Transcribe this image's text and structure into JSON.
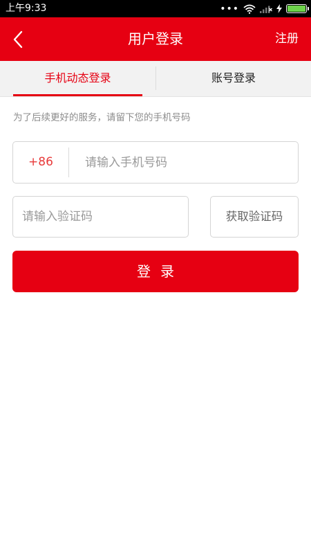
{
  "status_bar": {
    "time": "上午9:33",
    "icons": [
      "signal-dots-icon",
      "wifi-icon",
      "cellular-signal-icon",
      "charging-icon",
      "battery-icon"
    ],
    "battery_color": "#6ed34b"
  },
  "header": {
    "title": "用户登录",
    "back_icon": "chevron-left-icon",
    "register_label": "注册",
    "background": "#e60012"
  },
  "tabs": [
    {
      "label": "手机动态登录",
      "active": true
    },
    {
      "label": "账号登录",
      "active": false
    }
  ],
  "form": {
    "hint": "为了后续更好的服务，请留下您的手机号码",
    "country_code": "+86",
    "phone_placeholder": "请输入手机号码",
    "code_placeholder": "请输入验证码",
    "get_code_label": "获取验证码",
    "login_label": "登录"
  },
  "colors": {
    "accent": "#e60012",
    "country_code": "#e83a3a",
    "hint_text": "#8c8c8c"
  }
}
